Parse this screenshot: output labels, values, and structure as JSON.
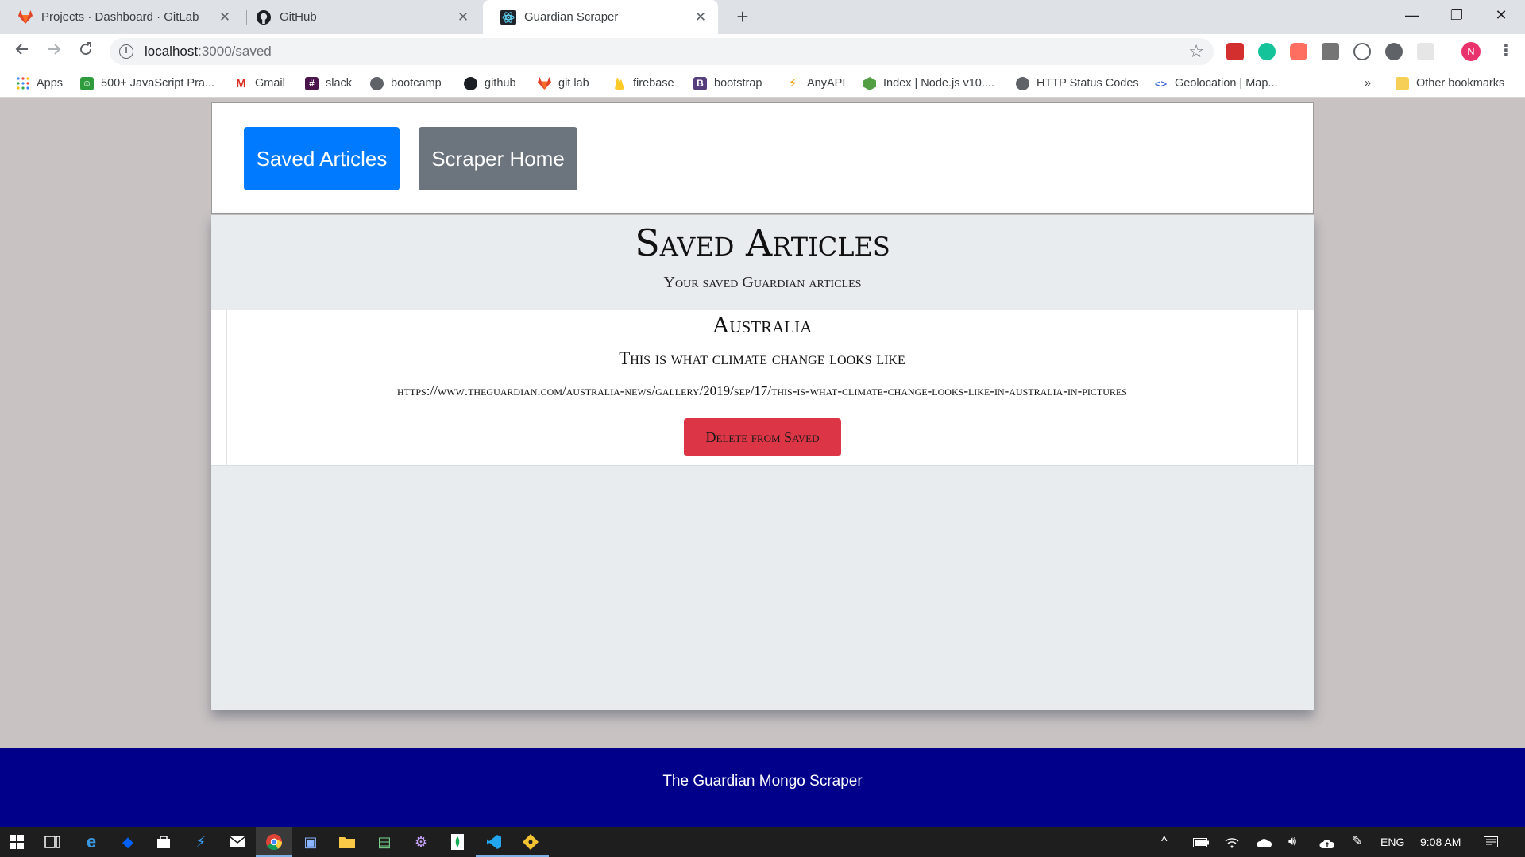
{
  "browser": {
    "tabs": [
      {
        "title": "Projects · Dashboard · GitLab",
        "icon": "gitlab-icon",
        "active": false
      },
      {
        "title": "GitHub",
        "icon": "github-icon",
        "active": false
      },
      {
        "title": "Guardian Scraper",
        "icon": "react-icon",
        "active": true
      }
    ],
    "new_tab_label": "+",
    "window_controls": {
      "minimize": "—",
      "restore": "❐",
      "close": "✕"
    },
    "close_glyph": "✕",
    "url": {
      "host": "localhost",
      "path": ":3000/saved"
    },
    "profile_initial": "N",
    "bookmarks": [
      {
        "label": "Apps",
        "icon": "apps-grid-icon"
      },
      {
        "label": "500+ JavaScript Pra...",
        "icon": "js-practice-icon"
      },
      {
        "label": "Gmail",
        "icon": "gmail-icon"
      },
      {
        "label": "slack",
        "icon": "slack-icon"
      },
      {
        "label": "bootcamp",
        "icon": "globe-icon"
      },
      {
        "label": "github",
        "icon": "github-icon"
      },
      {
        "label": "git lab",
        "icon": "gitlab-icon"
      },
      {
        "label": "firebase",
        "icon": "firebase-icon"
      },
      {
        "label": "bootstrap",
        "icon": "bootstrap-icon"
      },
      {
        "label": "AnyAPI",
        "icon": "bolt-icon"
      },
      {
        "label": "Index | Node.js v10....",
        "icon": "nodejs-icon"
      },
      {
        "label": "HTTP Status Codes",
        "icon": "globe-icon"
      },
      {
        "label": "Geolocation  |  Map...",
        "icon": "code-icon"
      }
    ],
    "overflow_label": "»",
    "other_bookmarks": "Other bookmarks"
  },
  "nav": {
    "saved_button": "Saved Articles",
    "home_button": "Scraper Home"
  },
  "page": {
    "title": "Saved Articles",
    "subtitle": "Your saved Guardian articles"
  },
  "articles": [
    {
      "category": "Australia",
      "headline": "This is what climate change looks like",
      "link": "https://www.theguardian.com/australia-news/gallery/2019/sep/17/this-is-what-climate-change-looks-like-in-australia-in-pictures",
      "delete_label": "Delete from Saved"
    }
  ],
  "footer": {
    "text": "The Guardian Mongo Scraper"
  },
  "taskbar": {
    "language": "ENG",
    "time": "9:08 AM"
  },
  "colors": {
    "primary": "#007bff",
    "secondary": "#6c757d",
    "danger": "#dc3545",
    "footer": "#00008b",
    "page_bg": "#c8c2c2",
    "jumbotron": "#e9ecef"
  }
}
